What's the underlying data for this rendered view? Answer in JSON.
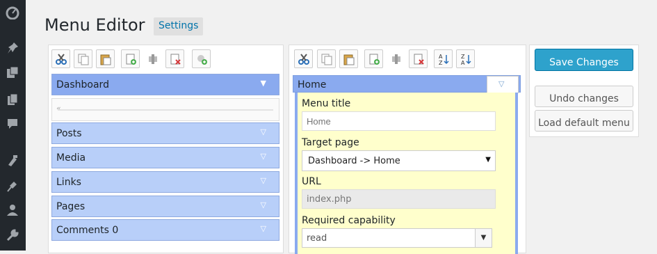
{
  "page": {
    "title": "Menu Editor",
    "settings_label": "Settings"
  },
  "adminbar": {
    "icons": [
      "dashboard-icon",
      "pin-icon",
      "media-icon",
      "pages-icon",
      "comments-icon",
      "appearance-icon",
      "plugins-icon",
      "users-icon",
      "tools-icon"
    ]
  },
  "toolbar1": [
    "cut-icon",
    "copy-icon",
    "paste-icon",
    "new-menu-icon",
    "new-separator-icon",
    "delete-icon",
    "new-item-icon"
  ],
  "toolbar2": [
    "cut-icon",
    "copy-icon",
    "paste-icon",
    "new-item-icon",
    "new-separator-icon",
    "delete-icon",
    "sort-ascending-icon",
    "sort-descending-icon"
  ],
  "menus": [
    {
      "label": "Dashboard",
      "active": true
    },
    {
      "label": "Posts"
    },
    {
      "label": "Media"
    },
    {
      "label": "Links"
    },
    {
      "label": "Pages"
    },
    {
      "label": "Comments 0"
    }
  ],
  "submenu": {
    "header": "Home",
    "fields": {
      "menu_title_label": "Menu title",
      "menu_title_placeholder": "Home",
      "target_page_label": "Target page",
      "target_page_value": "Dashboard -> Home",
      "url_label": "URL",
      "url_value": "index.php",
      "capability_label": "Required capability",
      "capability_value": "read"
    }
  },
  "actions": {
    "save": "Save Changes",
    "undo": "Undo changes",
    "load_default": "Load default menu"
  },
  "colors": {
    "accent": "#2ea2cc",
    "menu_bg": "#b8cff9",
    "menu_active": "#8aaaef",
    "editor_bg": "#ffffcc"
  }
}
